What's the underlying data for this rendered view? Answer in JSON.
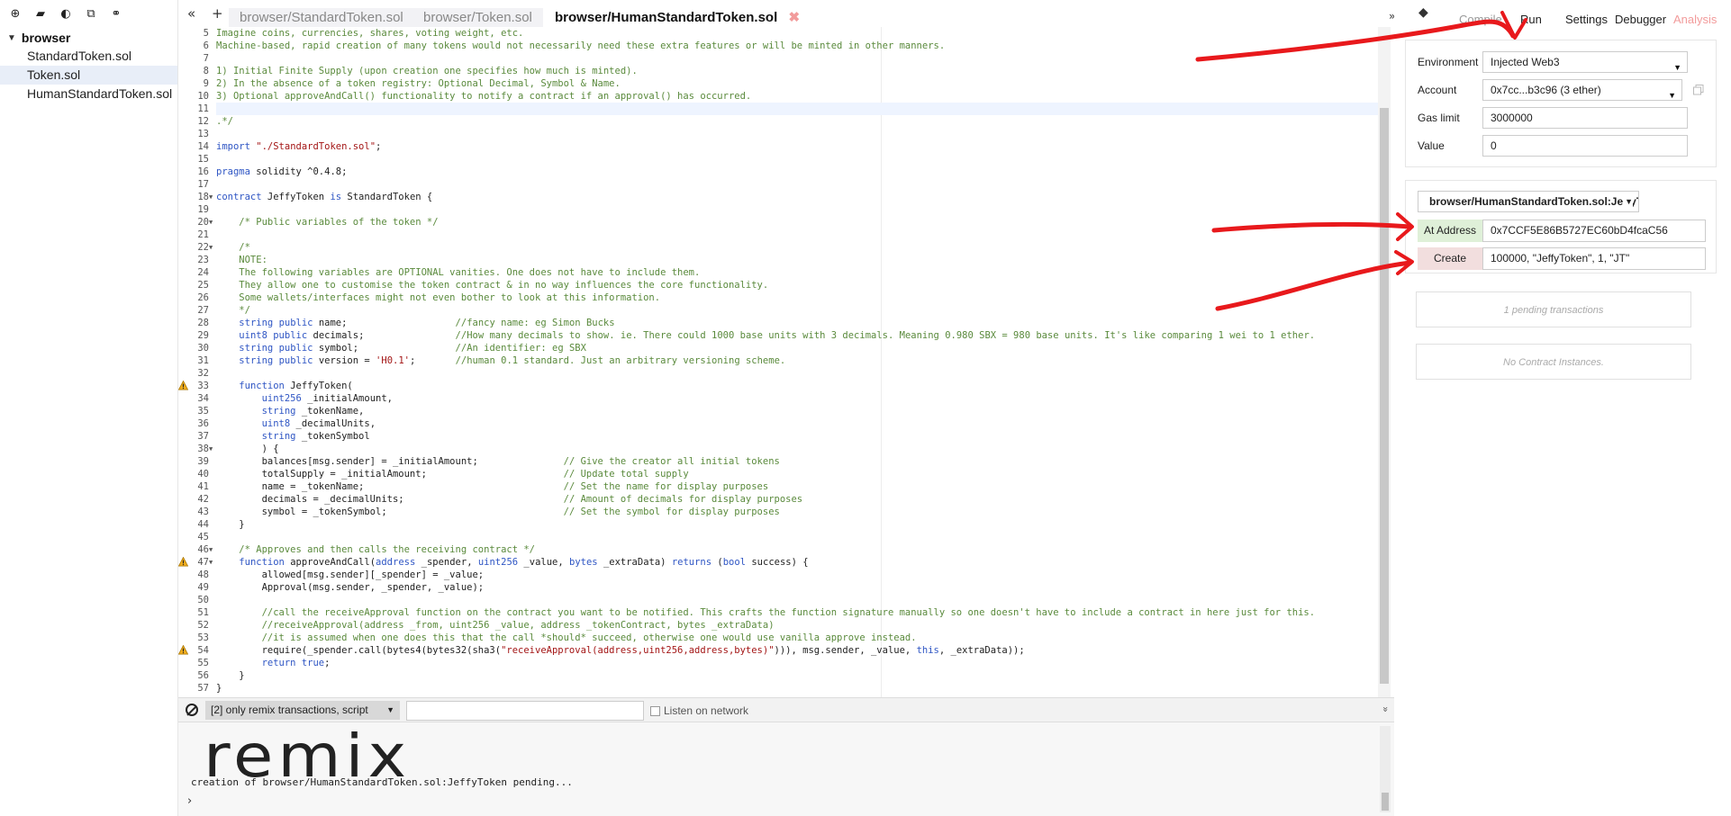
{
  "explorer": {
    "toolbar_icons": [
      "new-file-icon",
      "open-folder-icon",
      "github-icon",
      "copy-files-icon",
      "link-icon"
    ],
    "folder": "browser",
    "files": [
      "StandardToken.sol",
      "Token.sol",
      "HumanStandardToken.sol"
    ],
    "active_file_index": 1
  },
  "tabs": {
    "nav_left": "«",
    "nav_add": "+",
    "nav_right": "»",
    "items": [
      {
        "label": "browser/StandardToken.sol",
        "active": false
      },
      {
        "label": "browser/Token.sol",
        "active": false
      },
      {
        "label": "browser/HumanStandardToken.sol",
        "active": true
      }
    ],
    "close_glyph": "✖"
  },
  "editor": {
    "current_line": 11,
    "lines": [
      {
        "n": 5,
        "t": "Imagine coins, currencies, shares, voting weight, etc.",
        "k": "com"
      },
      {
        "n": 6,
        "t": "Machine-based, rapid creation of many tokens would not necessarily need these extra features or will be minted in other manners.",
        "k": "com"
      },
      {
        "n": 7,
        "t": "",
        "k": "plain"
      },
      {
        "n": 8,
        "t": "1) Initial Finite Supply (upon creation one specifies how much is minted).",
        "k": "com"
      },
      {
        "n": 9,
        "t": "2) In the absence of a token registry: Optional Decimal, Symbol & Name.",
        "k": "com"
      },
      {
        "n": 10,
        "t": "3) Optional approveAndCall() functionality to notify a contract if an approval() has occurred.",
        "k": "com"
      },
      {
        "n": 11,
        "t": "",
        "k": "plain"
      },
      {
        "n": 12,
        "t": ".*/",
        "k": "com"
      },
      {
        "n": 13,
        "t": "",
        "k": "plain"
      },
      {
        "n": 14,
        "t": "import \"./StandardToken.sol\";",
        "k": "plain"
      },
      {
        "n": 15,
        "t": "",
        "k": "plain"
      },
      {
        "n": 16,
        "t": "pragma solidity ^0.4.8;",
        "k": "plain"
      },
      {
        "n": 17,
        "t": "",
        "k": "plain"
      },
      {
        "n": 18,
        "t": "contract JeffyToken is StandardToken {",
        "k": "kwstart",
        "fold": true
      },
      {
        "n": 19,
        "t": "",
        "k": "plain"
      },
      {
        "n": 20,
        "t": "    /* Public variables of the token */",
        "k": "com",
        "fold": true
      },
      {
        "n": 21,
        "t": "",
        "k": "plain"
      },
      {
        "n": 22,
        "t": "    /*",
        "k": "com",
        "fold": true
      },
      {
        "n": 23,
        "t": "    NOTE:",
        "k": "com"
      },
      {
        "n": 24,
        "t": "    The following variables are OPTIONAL vanities. One does not have to include them.",
        "k": "com"
      },
      {
        "n": 25,
        "t": "    They allow one to customise the token contract & in no way influences the core functionality.",
        "k": "com"
      },
      {
        "n": 26,
        "t": "    Some wallets/interfaces might not even bother to look at this information.",
        "k": "com"
      },
      {
        "n": 27,
        "t": "    */",
        "k": "com"
      },
      {
        "n": 28,
        "t": "    string public name;                   //fancy name: eg Simon Bucks",
        "k": "decl"
      },
      {
        "n": 29,
        "t": "    uint8 public decimals;                //How many decimals to show. ie. There could 1000 base units with 3 decimals. Meaning 0.980 SBX = 980 base units. It's like comparing 1 wei to 1 ether.",
        "k": "decl"
      },
      {
        "n": 30,
        "t": "    string public symbol;                 //An identifier: eg SBX",
        "k": "decl"
      },
      {
        "n": 31,
        "t": "    string public version = 'H0.1';       //human 0.1 standard. Just an arbitrary versioning scheme.",
        "k": "decl"
      },
      {
        "n": 32,
        "t": "",
        "k": "plain"
      },
      {
        "n": 33,
        "t": "    function JeffyToken(",
        "k": "kwstart",
        "warn": true
      },
      {
        "n": 34,
        "t": "        uint256 _initialAmount,",
        "k": "kwstart"
      },
      {
        "n": 35,
        "t": "        string _tokenName,",
        "k": "kwstart"
      },
      {
        "n": 36,
        "t": "        uint8 _decimalUnits,",
        "k": "kwstart"
      },
      {
        "n": 37,
        "t": "        string _tokenSymbol",
        "k": "kwstart"
      },
      {
        "n": 38,
        "t": "        ) {",
        "k": "plain",
        "fold": true
      },
      {
        "n": 39,
        "t": "        balances[msg.sender] = _initialAmount;               // Give the creator all initial tokens",
        "k": "stmt"
      },
      {
        "n": 40,
        "t": "        totalSupply = _initialAmount;                        // Update total supply",
        "k": "stmt"
      },
      {
        "n": 41,
        "t": "        name = _tokenName;                                   // Set the name for display purposes",
        "k": "stmt"
      },
      {
        "n": 42,
        "t": "        decimals = _decimalUnits;                            // Amount of decimals for display purposes",
        "k": "stmt"
      },
      {
        "n": 43,
        "t": "        symbol = _tokenSymbol;                               // Set the symbol for display purposes",
        "k": "stmt"
      },
      {
        "n": 44,
        "t": "    }",
        "k": "plain"
      },
      {
        "n": 45,
        "t": "",
        "k": "plain"
      },
      {
        "n": 46,
        "t": "    /* Approves and then calls the receiving contract */",
        "k": "com",
        "fold": true
      },
      {
        "n": 47,
        "t": "    function approveAndCall(address _spender, uint256 _value, bytes _extraData) returns (bool success) {",
        "k": "kwstart",
        "warn": true,
        "fold": true
      },
      {
        "n": 48,
        "t": "        allowed[msg.sender][_spender] = _value;",
        "k": "plain"
      },
      {
        "n": 49,
        "t": "        Approval(msg.sender, _spender, _value);",
        "k": "plain"
      },
      {
        "n": 50,
        "t": "",
        "k": "plain"
      },
      {
        "n": 51,
        "t": "        //call the receiveApproval function on the contract you want to be notified. This crafts the function signature manually so one doesn't have to include a contract in here just for this.",
        "k": "com"
      },
      {
        "n": 52,
        "t": "        //receiveApproval(address _from, uint256 _value, address _tokenContract, bytes _extraData)",
        "k": "com"
      },
      {
        "n": 53,
        "t": "        //it is assumed when one does this that the call *should* succeed, otherwise one would use vanilla approve instead.",
        "k": "com"
      },
      {
        "n": 54,
        "t": "        require(_spender.call(bytes4(bytes32(sha3(\"receiveApproval(address,uint256,address,bytes)\"))), msg.sender, _value, this, _extraData));",
        "k": "plain",
        "warn": true
      },
      {
        "n": 55,
        "t": "        return true;",
        "k": "kwstart"
      },
      {
        "n": 56,
        "t": "    }",
        "k": "plain"
      },
      {
        "n": 57,
        "t": "}",
        "k": "plain"
      }
    ]
  },
  "terminal": {
    "filter": "[2] only remix transactions, script",
    "listen_label": "Listen on network",
    "collapse": "»",
    "logo": "remix",
    "log": "creation of browser/HumanStandardToken.sol:JeffyToken pending...",
    "prompt": "›"
  },
  "right_panel": {
    "collapse": "»",
    "tabs": [
      {
        "label": "Compile",
        "style": "dim"
      },
      {
        "label": "Run",
        "style": "normal"
      },
      {
        "label": "Settings",
        "style": "normal"
      },
      {
        "label": "Debugger",
        "style": "normal"
      },
      {
        "label": "Analysis",
        "style": "analysis"
      }
    ],
    "environment": {
      "label": "Environment",
      "value": "Injected Web3"
    },
    "account": {
      "label": "Account",
      "value": "0x7cc...b3c96 (3 ether)"
    },
    "gas_limit": {
      "label": "Gas limit",
      "value": "3000000"
    },
    "value": {
      "label": "Value",
      "value": "0"
    },
    "contract_select": "browser/HumanStandardToken.sol:JeffyToken",
    "at_address": {
      "label": "At Address",
      "value": "0x7CCF5E86B5727EC60bD4fcaC56",
      "color": "#dff0d8"
    },
    "create": {
      "label": "Create",
      "value": "100000, \"JeffyToken\", 1, \"JT\"",
      "color": "#f2dede"
    },
    "pending": "1 pending transactions",
    "no_instances": "No Contract Instances."
  },
  "colors": {
    "annotation": "#e8191c",
    "keyword": "#2f56c4",
    "comment": "#5a8a3c"
  }
}
